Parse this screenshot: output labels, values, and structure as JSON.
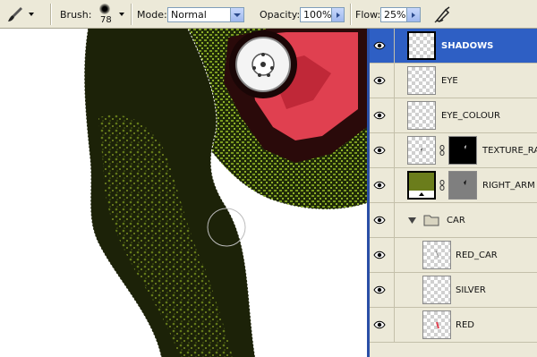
{
  "options_bar": {
    "brush_label": "Brush:",
    "brush_size": "78",
    "mode_label": "Mode:",
    "mode_value": "Normal",
    "opacity_label": "Opacity:",
    "opacity_value": "100%",
    "flow_label": "Flow:",
    "flow_value": "25%",
    "icons": [
      "brush-tool-icon",
      "airbrush-icon"
    ]
  },
  "layers": [
    {
      "name": "SHADOWS",
      "selected": true,
      "thumb": "transparent"
    },
    {
      "name": "EYE",
      "selected": false,
      "thumb": "transparent"
    },
    {
      "name": "EYE_COLOUR",
      "selected": false,
      "thumb": "transparent"
    },
    {
      "name": "TEXTURE_RA",
      "selected": false,
      "thumb": "transparent",
      "mask": "black"
    },
    {
      "name": "RIGHT_ARM",
      "selected": false,
      "thumb": "olive",
      "mask": "gray"
    },
    {
      "name": "CAR",
      "selected": false,
      "group": true,
      "expanded": true
    },
    {
      "name": "RED_CAR",
      "selected": false,
      "thumb": "transparent",
      "indent": true
    },
    {
      "name": "SILVER",
      "selected": false,
      "thumb": "transparent",
      "indent": true
    },
    {
      "name": "RED",
      "selected": false,
      "thumb": "transparent",
      "indent": true
    }
  ],
  "colors": {
    "selection": "#2e5fc4",
    "panel_bg": "#ece9d8",
    "arm_dark": "#1c2208",
    "arm_texture": "#6f8a1c",
    "car_red": "#e04050"
  }
}
